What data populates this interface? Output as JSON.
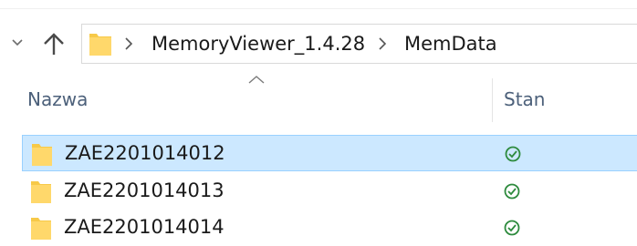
{
  "address_bar": {
    "breadcrumbs": [
      "MemoryViewer_1.4.28",
      "MemData"
    ],
    "folder_icon": "folder-icon",
    "separator_icon": "chevron-right-icon"
  },
  "navigation": {
    "recent_icon": "chevron-down-icon",
    "up_icon": "arrow-up-icon"
  },
  "columns": {
    "name": "Nazwa",
    "status": "Stan",
    "sort_icon": "sort-ascending-icon"
  },
  "files": [
    {
      "name": "ZAE2201014012",
      "status_icon": "sync-ok-icon",
      "selected": true
    },
    {
      "name": "ZAE2201014013",
      "status_icon": "sync-ok-icon",
      "selected": false
    },
    {
      "name": "ZAE2201014014",
      "status_icon": "sync-ok-icon",
      "selected": false
    }
  ],
  "colors": {
    "selection_bg": "#cce8ff",
    "selection_border": "#99d1ff",
    "folder": "#ffd86b",
    "status_ok": "#2e8b3e",
    "header_text": "#4c607a"
  }
}
